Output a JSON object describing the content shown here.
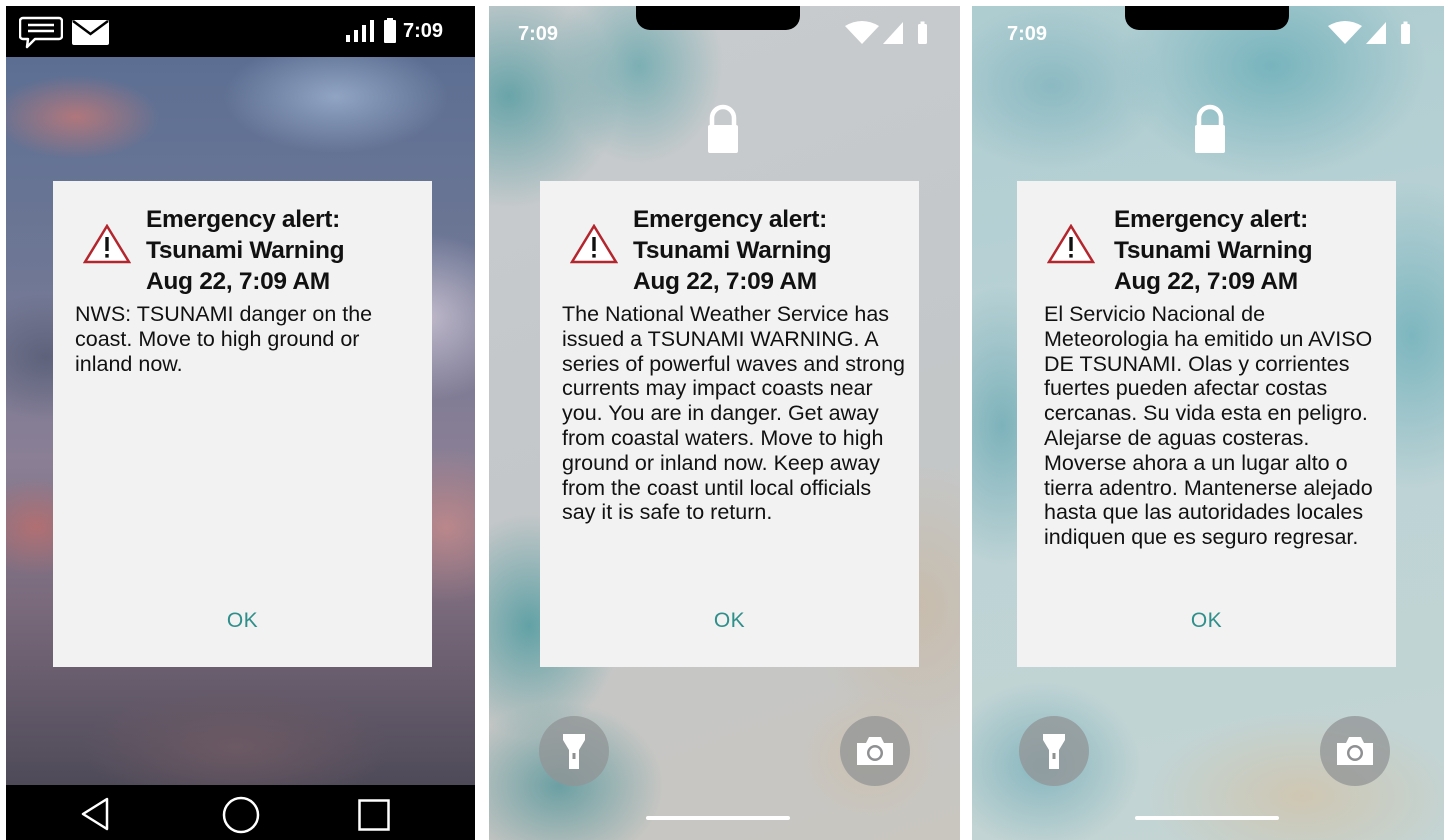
{
  "phone1": {
    "status_time": "7:09",
    "icons": {
      "message": "message-icon",
      "mail": "mail-icon",
      "signal": "signal-icon",
      "battery": "battery-icon"
    },
    "alert": {
      "title_line1": "Emergency alert:",
      "title_line2": "Tsunami Warning",
      "title_line3": "Aug 22, 7:09 AM",
      "body": "NWS: TSUNAMI danger on the coast. Move to high ground or inland now.",
      "ok_label": "OK"
    },
    "nav": {
      "back": "back-triangle-icon",
      "home": "home-circle-icon",
      "recents": "recents-square-icon"
    }
  },
  "phone2": {
    "status_time": "7:09",
    "alert": {
      "title_line1": "Emergency alert:",
      "title_line2": "Tsunami Warning",
      "title_line3": "Aug 22, 7:09 AM",
      "body": "The National Weather Service has issued a TSUNAMI WARNING. A series of powerful waves and strong currents may impact coasts near you. You are in danger. Get away from coastal waters. Move to high ground or inland now. Keep away from the coast until local officials say it is safe to return.",
      "ok_label": "OK"
    }
  },
  "phone3": {
    "status_time": "7:09",
    "alert": {
      "title_line1": "Emergency alert:",
      "title_line2": "Tsunami Warning",
      "title_line3": "Aug 22, 7:09 AM",
      "body": "El Servicio Nacional de Meteorologia ha emitido un AVISO DE TSUNAMI. Olas y corrientes fuertes pueden afectar costas cercanas. Su vida esta en peligro. Alejarse de aguas costeras. Moverse ahora a un lugar alto o tierra adentro. Mantenerse alejado hasta que las autoridades locales indiquen que es seguro regresar.",
      "ok_label": "OK"
    }
  },
  "colors": {
    "accent_ok": "#2f8f8b",
    "warning_red": "#b3262e",
    "dialog_bg": "#f2f2f2"
  }
}
